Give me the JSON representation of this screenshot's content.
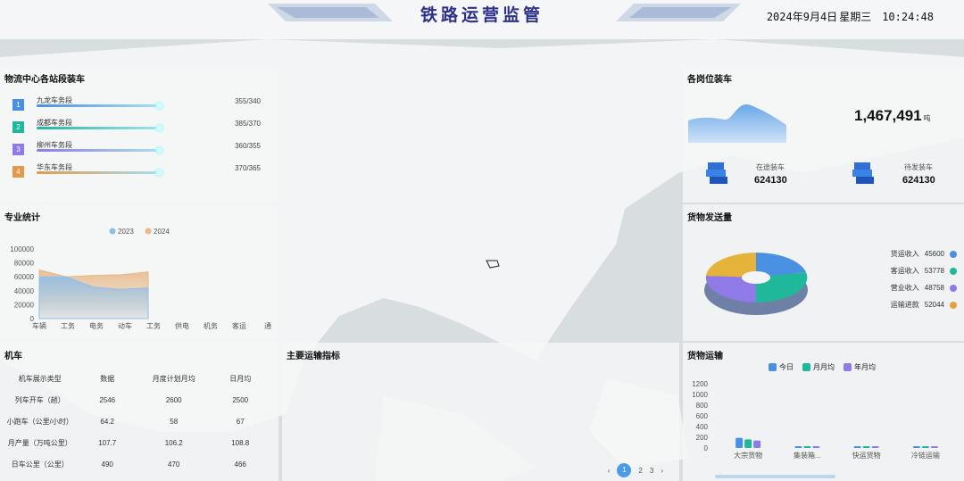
{
  "header": {
    "title": "铁路运营监管",
    "date": "2024年9月4日",
    "weekday": "星期三",
    "time": "10:24:48"
  },
  "loading": {
    "title": "物流中心各站段装车",
    "items": [
      {
        "rank": "1",
        "name": "九龙车务段",
        "value": "355/340",
        "color": "#4a90e2",
        "fill": 0.72
      },
      {
        "rank": "2",
        "name": "成都车务段",
        "value": "385/370",
        "color": "#1fb89a",
        "fill": 0.72
      },
      {
        "rank": "3",
        "name": "柳州车务段",
        "value": "360/355",
        "color": "#8f7ae8",
        "fill": 0.72
      },
      {
        "rank": "4",
        "name": "华东车务段",
        "value": "370/365",
        "color": "#e29a4a",
        "fill": 0.72
      }
    ]
  },
  "professional": {
    "title": "专业统计",
    "legend": [
      "2023",
      "2024"
    ]
  },
  "locomotive": {
    "title": "机车",
    "headers": [
      "机车展示类型",
      "数据",
      "月度计划月均",
      "日月均"
    ],
    "rows": [
      [
        "列车开车（趟）",
        "2546",
        "2600",
        "2500"
      ],
      [
        "小跑车（公里/小时）",
        "64.2",
        "58",
        "67"
      ],
      [
        "月产量（万吨公里）",
        "107.7",
        "106.2",
        "108.8"
      ],
      [
        "日车公里（公里）",
        "490",
        "470",
        "466"
      ]
    ]
  },
  "indicators": {
    "title": "主要运输指标",
    "pages": [
      "1",
      "2",
      "3"
    ],
    "prev": "‹",
    "next": "›"
  },
  "station_loading": {
    "title": "各岗位装车",
    "total": "1,467,491",
    "unit": "吨",
    "left_label": "在途装车",
    "left_value": "624130",
    "right_label": "待发装车",
    "right_value": "624130"
  },
  "shipping": {
    "title": "货物发送量",
    "items": [
      {
        "label": "货运收入",
        "value": "45600",
        "color": "#4a90e2"
      },
      {
        "label": "客运收入",
        "value": "53778",
        "color": "#1fb89a"
      },
      {
        "label": "营业收入",
        "value": "48758",
        "color": "#8f7ae8"
      },
      {
        "label": "运输进款",
        "value": "52044",
        "color": "#e5a23a"
      }
    ]
  },
  "transport": {
    "title": "货物运输",
    "legend": [
      {
        "label": "今日",
        "color": "#4a90e2"
      },
      {
        "label": "月月均",
        "color": "#1fb89a"
      },
      {
        "label": "年月均",
        "color": "#8f7ae8"
      }
    ]
  },
  "chart_data": [
    {
      "type": "area",
      "title": "专业统计",
      "categories": [
        "车辆",
        "工务",
        "电务",
        "动车",
        "工务",
        "供电",
        "机务",
        "客运",
        "通"
      ],
      "ylim": [
        0,
        100000
      ],
      "yticks": [
        0,
        20000,
        40000,
        60000,
        80000,
        100000
      ],
      "series": [
        {
          "name": "2023",
          "values": [
            60000,
            60000,
            45000,
            42000,
            44000
          ],
          "color": "#8fbfe8"
        },
        {
          "name": "2024",
          "values": [
            70000,
            60000,
            62000,
            63000,
            67000
          ],
          "color": "#e8b98a"
        }
      ]
    },
    {
      "type": "bar",
      "title": "货物运输",
      "categories": [
        "大宗货物",
        "集装箱...",
        "快运货物",
        "冷链运输"
      ],
      "ylim": [
        0,
        1200
      ],
      "yticks": [
        0,
        200,
        400,
        600,
        800,
        1000,
        1200
      ],
      "series": [
        {
          "name": "今日",
          "values": [
            190,
            5,
            20,
            10
          ],
          "color": "#4a90e2"
        },
        {
          "name": "月月均",
          "values": [
            160,
            5,
            20,
            10
          ],
          "color": "#1fb89a"
        },
        {
          "name": "年月均",
          "values": [
            140,
            5,
            20,
            10
          ],
          "color": "#8f7ae8"
        }
      ]
    }
  ]
}
